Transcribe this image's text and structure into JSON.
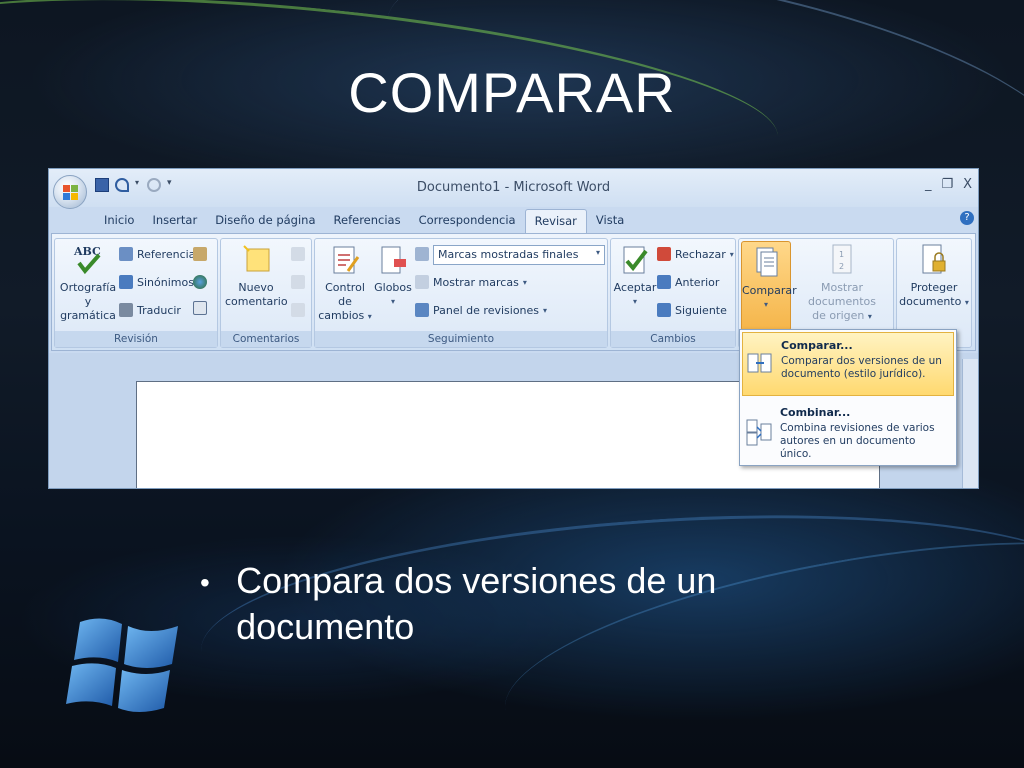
{
  "slide": {
    "title": "COMPARAR",
    "bullet": "Compara dos versiones de un documento"
  },
  "word": {
    "window_title": "Documento1 - Microsoft Word",
    "tabs": [
      "Inicio",
      "Insertar",
      "Diseño de página",
      "Referencias",
      "Correspondencia",
      "Revisar",
      "Vista"
    ],
    "active_tab": "Revisar",
    "groups": {
      "revision": {
        "label": "Revisión",
        "ortografia_line1": "Ortografía",
        "ortografia_line2": "y gramática",
        "referencia": "Referencia",
        "sinonimos": "Sinónimos",
        "traducir": "Traducir",
        "abc_icon": "ABC"
      },
      "comentarios": {
        "label": "Comentarios",
        "nuevo_line1": "Nuevo",
        "nuevo_line2": "comentario"
      },
      "seguimiento": {
        "label": "Seguimiento",
        "control_line1": "Control de",
        "control_line2": "cambios",
        "globos": "Globos",
        "marcas_combo": "Marcas mostradas finales",
        "mostrar_marcas": "Mostrar marcas",
        "panel_revisiones": "Panel de revisiones"
      },
      "cambios": {
        "label": "Cambios",
        "aceptar": "Aceptar",
        "rechazar": "Rechazar",
        "anterior": "Anterior",
        "siguiente": "Siguiente"
      },
      "comparar": {
        "comparar": "Comparar",
        "mostrar_line1": "Mostrar documentos",
        "mostrar_line2": "de origen"
      },
      "proteger": {
        "line1": "Proteger",
        "line2": "documento"
      }
    },
    "dropdown": {
      "item1_title": "Comparar...",
      "item1_desc1": "Comparar dos versiones de un",
      "item1_desc2": "documento (estilo jurídico).",
      "item2_title": "Combinar...",
      "item2_desc1": "Combina revisiones de varios",
      "item2_desc2": "autores en un documento único."
    },
    "window_controls": [
      "_",
      "❐",
      "X"
    ]
  }
}
